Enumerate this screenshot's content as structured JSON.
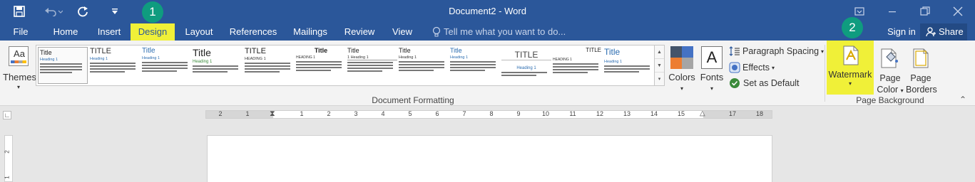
{
  "titlebar": {
    "title": "Document2  -  Word",
    "icons": [
      "save-icon",
      "undo-icon",
      "redo-icon",
      "customize-qat-icon",
      "ribbon-display-icon",
      "minimize-icon",
      "restore-icon",
      "close-icon"
    ]
  },
  "tabs": {
    "items": [
      "File",
      "Home",
      "Insert",
      "Design",
      "Layout",
      "References",
      "Mailings",
      "Review",
      "View"
    ],
    "tell_me": "Tell me what you want to do...",
    "sign_in": "Sign in",
    "share": "Share",
    "active": "Design"
  },
  "badges": {
    "b1": "1",
    "b2": "2"
  },
  "ribbon": {
    "themes": "Themes",
    "gallery": [
      {
        "title": "Title",
        "heading": "Heading 1"
      },
      {
        "title": "TITLE",
        "heading": "Heading 1"
      },
      {
        "title": "Title",
        "heading": "Heading 1"
      },
      {
        "title": "Title",
        "heading": "Heading 1"
      },
      {
        "title": "TITLE",
        "heading": "HEADING 1"
      },
      {
        "title": "Title",
        "heading": "HEADING 1"
      },
      {
        "title": "Title",
        "heading": "1   Heading 1"
      },
      {
        "title": "Title",
        "heading": "Heading 1"
      },
      {
        "title": "Title",
        "heading": "Heading 1"
      },
      {
        "title": "TITLE",
        "heading": "Heading 1"
      },
      {
        "title": "TITLE",
        "heading": "HEADING 1"
      },
      {
        "title": "Title",
        "heading": "Heading 1"
      }
    ],
    "colors": "Colors",
    "fonts": "Fonts",
    "fonts_glyph": "A",
    "paragraph_spacing": "Paragraph Spacing",
    "effects": "Effects",
    "set_as_default": "Set as Default",
    "document_formatting": "Document Formatting",
    "watermark": "Watermark",
    "page_color_1": "Page",
    "page_color_2": "Color",
    "page_borders_1": "Page",
    "page_borders_2": "Borders",
    "page_background": "Page Background"
  },
  "ruler": {
    "ticks": [
      "2",
      "1",
      "1",
      "2",
      "3",
      "4",
      "5",
      "6",
      "7",
      "8",
      "9",
      "10",
      "11",
      "12",
      "13",
      "14",
      "15",
      "17",
      "18"
    ]
  },
  "vruler": {
    "ticks": [
      "1",
      "2"
    ]
  },
  "colors": {
    "accent": "#2b579a",
    "highlight": "#f0f038",
    "badge": "#0f9c7f"
  }
}
